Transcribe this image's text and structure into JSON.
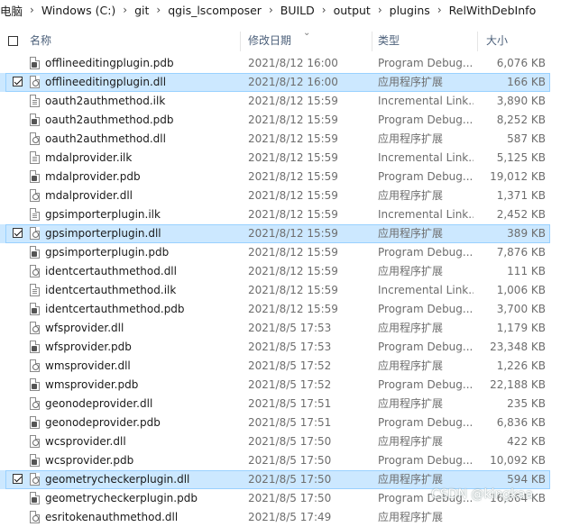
{
  "breadcrumb": [
    "电脑",
    "Windows (C:)",
    "git",
    "qgis_lscomposer",
    "BUILD",
    "output",
    "plugins",
    "RelWithDebInfo"
  ],
  "columns": {
    "name": "名称",
    "date": "修改日期",
    "type": "类型",
    "size": "大小"
  },
  "files": [
    {
      "name": "offlineeditingplugin.pdb",
      "date": "2021/8/12 16:00",
      "type": "Program Debug...",
      "size": "6,076 KB",
      "icon": "pdb",
      "selected": false
    },
    {
      "name": "offlineeditingplugin.dll",
      "date": "2021/8/12 16:00",
      "type": "应用程序扩展",
      "size": "166 KB",
      "icon": "dll",
      "selected": true
    },
    {
      "name": "oauth2authmethod.ilk",
      "date": "2021/8/12 15:59",
      "type": "Incremental Link...",
      "size": "3,890 KB",
      "icon": "ilk",
      "selected": false
    },
    {
      "name": "oauth2authmethod.pdb",
      "date": "2021/8/12 15:59",
      "type": "Program Debug...",
      "size": "8,252 KB",
      "icon": "pdb",
      "selected": false
    },
    {
      "name": "oauth2authmethod.dll",
      "date": "2021/8/12 15:59",
      "type": "应用程序扩展",
      "size": "587 KB",
      "icon": "dll",
      "selected": false
    },
    {
      "name": "mdalprovider.ilk",
      "date": "2021/8/12 15:59",
      "type": "Incremental Link...",
      "size": "5,125 KB",
      "icon": "ilk",
      "selected": false
    },
    {
      "name": "mdalprovider.pdb",
      "date": "2021/8/12 15:59",
      "type": "Program Debug...",
      "size": "19,012 KB",
      "icon": "pdb",
      "selected": false
    },
    {
      "name": "mdalprovider.dll",
      "date": "2021/8/12 15:59",
      "type": "应用程序扩展",
      "size": "1,371 KB",
      "icon": "dll",
      "selected": false
    },
    {
      "name": "gpsimporterplugin.ilk",
      "date": "2021/8/12 15:59",
      "type": "Incremental Link...",
      "size": "2,452 KB",
      "icon": "ilk",
      "selected": false
    },
    {
      "name": "gpsimporterplugin.dll",
      "date": "2021/8/12 15:59",
      "type": "应用程序扩展",
      "size": "389 KB",
      "icon": "dll",
      "selected": true
    },
    {
      "name": "gpsimporterplugin.pdb",
      "date": "2021/8/12 15:59",
      "type": "Program Debug...",
      "size": "7,876 KB",
      "icon": "pdb",
      "selected": false
    },
    {
      "name": "identcertauthmethod.dll",
      "date": "2021/8/12 15:59",
      "type": "应用程序扩展",
      "size": "111 KB",
      "icon": "dll",
      "selected": false
    },
    {
      "name": "identcertauthmethod.ilk",
      "date": "2021/8/12 15:59",
      "type": "Incremental Link...",
      "size": "1,006 KB",
      "icon": "ilk",
      "selected": false
    },
    {
      "name": "identcertauthmethod.pdb",
      "date": "2021/8/12 15:59",
      "type": "Program Debug...",
      "size": "3,700 KB",
      "icon": "pdb",
      "selected": false
    },
    {
      "name": "wfsprovider.dll",
      "date": "2021/8/5 17:53",
      "type": "应用程序扩展",
      "size": "1,179 KB",
      "icon": "dll",
      "selected": false
    },
    {
      "name": "wfsprovider.pdb",
      "date": "2021/8/5 17:53",
      "type": "Program Debug...",
      "size": "23,348 KB",
      "icon": "pdb",
      "selected": false
    },
    {
      "name": "wmsprovider.dll",
      "date": "2021/8/5 17:52",
      "type": "应用程序扩展",
      "size": "1,226 KB",
      "icon": "dll",
      "selected": false
    },
    {
      "name": "wmsprovider.pdb",
      "date": "2021/8/5 17:52",
      "type": "Program Debug...",
      "size": "22,188 KB",
      "icon": "pdb",
      "selected": false
    },
    {
      "name": "geonodeprovider.dll",
      "date": "2021/8/5 17:51",
      "type": "应用程序扩展",
      "size": "235 KB",
      "icon": "dll",
      "selected": false
    },
    {
      "name": "geonodeprovider.pdb",
      "date": "2021/8/5 17:51",
      "type": "Program Debug...",
      "size": "6,836 KB",
      "icon": "pdb",
      "selected": false
    },
    {
      "name": "wcsprovider.dll",
      "date": "2021/8/5 17:50",
      "type": "应用程序扩展",
      "size": "422 KB",
      "icon": "dll",
      "selected": false
    },
    {
      "name": "wcsprovider.pdb",
      "date": "2021/8/5 17:50",
      "type": "Program Debug...",
      "size": "10,092 KB",
      "icon": "pdb",
      "selected": false
    },
    {
      "name": "geometrycheckerplugin.dll",
      "date": "2021/8/5 17:50",
      "type": "应用程序扩展",
      "size": "594 KB",
      "icon": "dll",
      "selected": true
    },
    {
      "name": "geometrycheckerplugin.pdb",
      "date": "2021/8/5 17:50",
      "type": "Program Debug...",
      "size": "16,664 KB",
      "icon": "pdb",
      "selected": false
    },
    {
      "name": "esritokenauthmethod.dll",
      "date": "2021/8/5 17:49",
      "type": "应用程序扩展",
      "size": "",
      "icon": "dll",
      "selected": false
    }
  ],
  "watermark": "CSDN @kingkaa",
  "colors": {
    "selection_bg": "#cce8ff",
    "selection_border": "#99d1ff",
    "header_text": "#4c607a"
  }
}
